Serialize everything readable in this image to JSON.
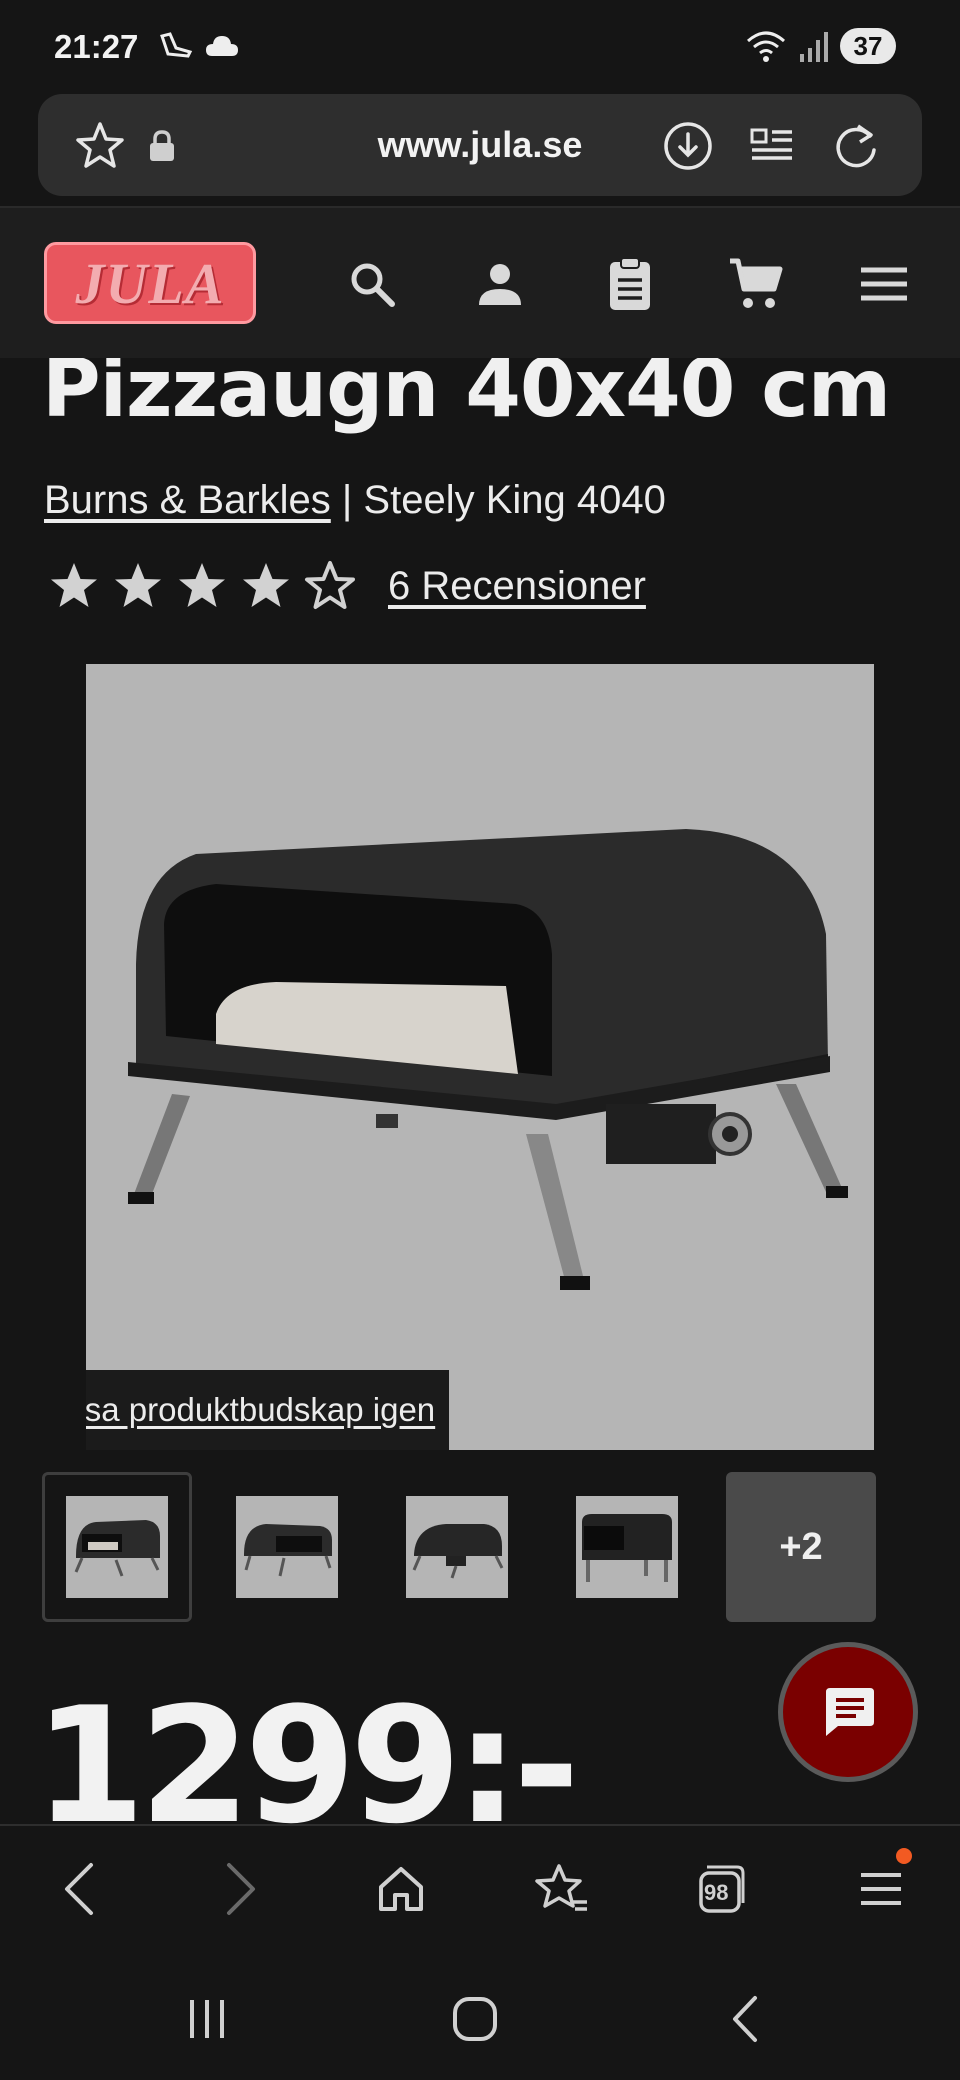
{
  "status_bar": {
    "time": "21:27",
    "battery": "37"
  },
  "browser": {
    "url": "www.jula.se",
    "tab_count": "98"
  },
  "site": {
    "logo_text": "JULA"
  },
  "product": {
    "title": "Pizzaugn 40x40 cm",
    "brand": "Burns & Barkles",
    "separator": " | ",
    "model": "Steely King 4040",
    "rating": 4,
    "rating_max": 5,
    "reviews": "6 Recensioner",
    "message_link": "Visa produktbudskap igen",
    "more_images": "+2",
    "price": "1299:-"
  },
  "colors": {
    "background": "#151515",
    "accent_red": "#e8565e",
    "chat_button": "#7a0000",
    "notification_dot": "#f25a22"
  }
}
